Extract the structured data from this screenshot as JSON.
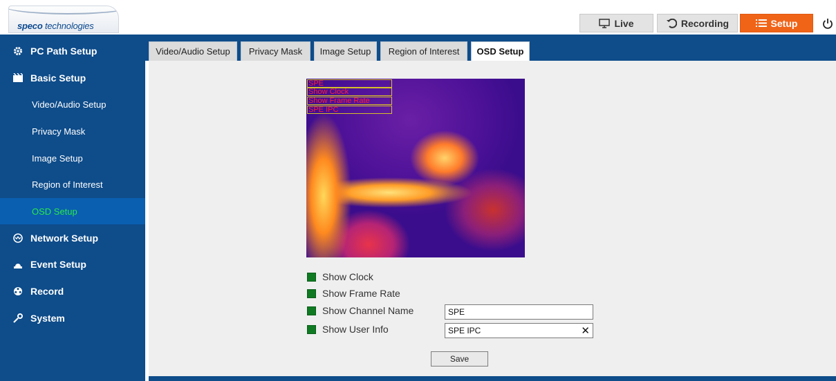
{
  "header": {
    "logo_bold": "speco",
    "logo_rest": " technologies",
    "live_label": "Live",
    "recording_label": "Recording",
    "setup_label": "Setup"
  },
  "colors": {
    "brand_blue": "#0e4c8a",
    "setup_orange": "#f06418",
    "active_green": "#29e84a",
    "checkbox_green": "#0f7a22"
  },
  "sidebar": {
    "items": [
      {
        "label": "PC Path Setup",
        "icon": "gear-icon"
      },
      {
        "label": "Basic Setup",
        "icon": "video-icon"
      },
      {
        "label": "Video/Audio Setup"
      },
      {
        "label": "Privacy Mask"
      },
      {
        "label": "Image Setup"
      },
      {
        "label": "Region of Interest"
      },
      {
        "label": "OSD Setup",
        "active": true
      },
      {
        "label": "Network Setup",
        "icon": "network-icon"
      },
      {
        "label": "Event Setup",
        "icon": "alarm-icon"
      },
      {
        "label": "Record",
        "icon": "reel-icon"
      },
      {
        "label": "System",
        "icon": "wrench-icon"
      }
    ]
  },
  "tabs": [
    "Video/Audio Setup",
    "Privacy Mask",
    "Image Setup",
    "Region of Interest",
    "OSD Setup"
  ],
  "active_tab": "OSD Setup",
  "preview": {
    "osd_lines": [
      "SPE",
      "Show Clock",
      "Show Frame Rate",
      "SPE IPC"
    ]
  },
  "options": {
    "show_clock": {
      "label": "Show Clock",
      "checked": true
    },
    "show_frame_rate": {
      "label": "Show Frame Rate",
      "checked": true
    },
    "show_channel_name": {
      "label": "Show Channel Name",
      "checked": true,
      "value": "SPE"
    },
    "show_user_info": {
      "label": "Show User Info",
      "checked": true,
      "value": "SPE IPC",
      "clear": "✕"
    }
  },
  "save_label": "Save"
}
